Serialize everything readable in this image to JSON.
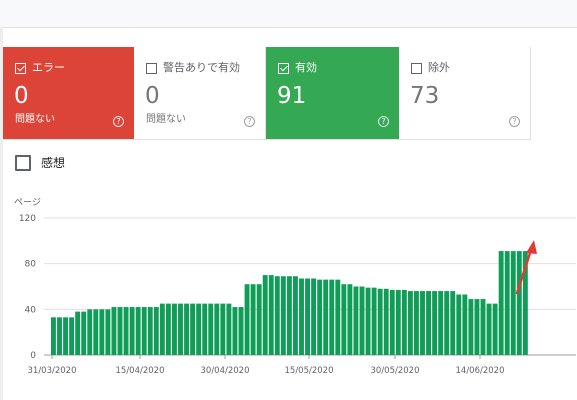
{
  "cards": [
    {
      "label": "エラー",
      "value": "0",
      "sub": "問題ない",
      "checked": true,
      "color": "#db4437",
      "help": "?"
    },
    {
      "label": "警告ありで有効",
      "value": "0",
      "sub": "問題ない",
      "checked": false,
      "color": "#ffffff",
      "help": "?"
    },
    {
      "label": "有効",
      "value": "91",
      "sub": "",
      "checked": true,
      "color": "#34a853",
      "help": "?"
    },
    {
      "label": "除外",
      "value": "73",
      "sub": "",
      "checked": false,
      "color": "#ffffff",
      "help": "?"
    }
  ],
  "impressions": {
    "label": "感想",
    "checked": false
  },
  "chart_data": {
    "type": "bar",
    "ylabel": "ページ",
    "ylim": [
      0,
      120
    ],
    "yticks": [
      0,
      40,
      80,
      120
    ],
    "xticks": [
      "31/03/2020",
      "15/04/2020",
      "30/04/2020",
      "15/05/2020",
      "30/05/2020",
      "14/06/2020"
    ],
    "color": "#0f9d58",
    "values": [
      33,
      33,
      33,
      33,
      38,
      38,
      40,
      40,
      40,
      40,
      42,
      42,
      42,
      42,
      42,
      42,
      42,
      42,
      45,
      45,
      45,
      45,
      45,
      45,
      45,
      45,
      45,
      45,
      45,
      45,
      42,
      42,
      62,
      62,
      62,
      70,
      70,
      69,
      69,
      69,
      69,
      67,
      67,
      67,
      66,
      66,
      66,
      66,
      62,
      62,
      60,
      60,
      59,
      59,
      58,
      58,
      57,
      57,
      57,
      56,
      56,
      56,
      56,
      56,
      56,
      56,
      56,
      53,
      53,
      49,
      49,
      49,
      45,
      45,
      91,
      91,
      91,
      91,
      91
    ],
    "annotation": {
      "type": "arrow",
      "color": "#e53935"
    }
  }
}
